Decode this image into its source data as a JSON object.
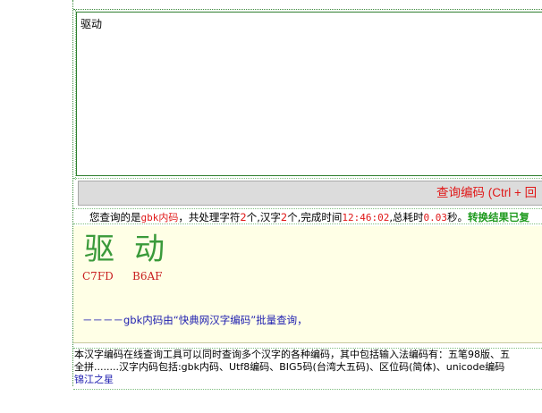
{
  "input": {
    "value": "驱动"
  },
  "query_button": {
    "label": "查询编码 (Ctrl + 回"
  },
  "status": {
    "prefix": "您查询的是",
    "encoding": "gbk内码",
    "part1": "，共处理字符",
    "char_count": "2",
    "part2": "个,汉字",
    "hanzi_count": "2",
    "part3": "个,完成时间",
    "time": "12:46:02",
    "part4": ",总耗时",
    "elapsed": "0.03",
    "part5": "秒。",
    "result_note": "转换结果已复"
  },
  "results": [
    {
      "char": "驱",
      "code": "C7FD"
    },
    {
      "char": "动",
      "code": "B6AF"
    }
  ],
  "credit": "－－－－gbk内码由“快典网汉字编码”批量查询，",
  "description": {
    "line1": "本汉字编码在线查询工具可以同时查询多个汉字的各种编码，其中包括输入法编码有：五笔98版、五",
    "line2": "全拼........汉字内码包括:gbk内码、Utf8编码、BIG5码(台湾大五码)、区位码(简体)、unicode编码",
    "link": "锦江之星"
  }
}
